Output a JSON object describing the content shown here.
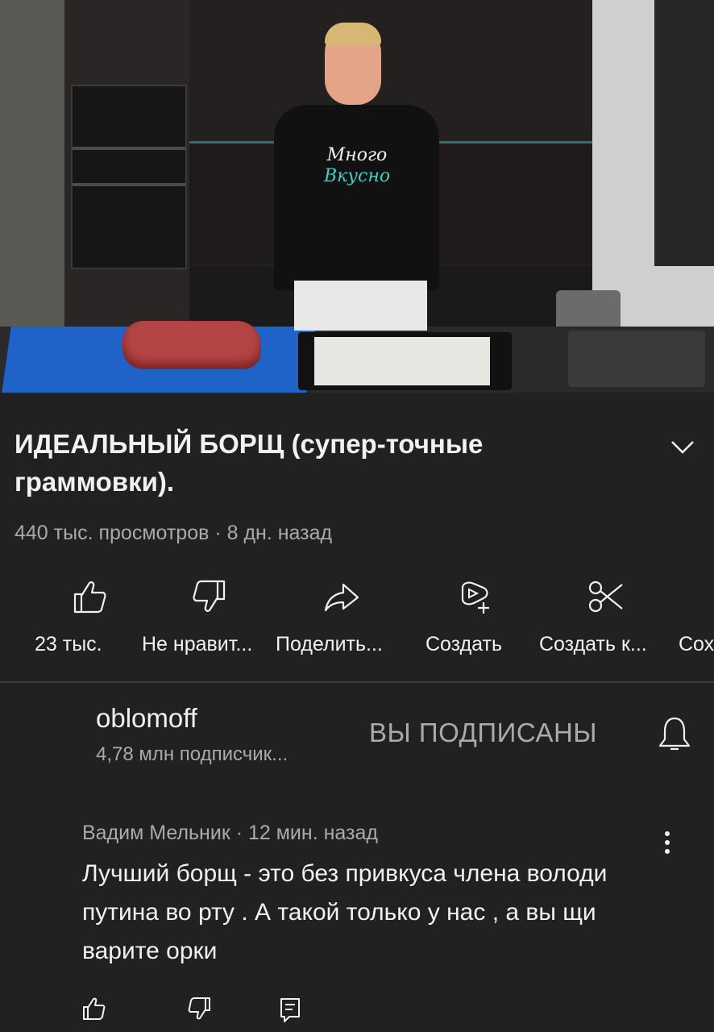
{
  "video": {
    "shirt_text_top": "Много",
    "shirt_text_bottom": "Вкусно"
  },
  "title": "ИДЕАЛЬНЫЙ БОРЩ (супер-точные граммовки).",
  "meta": "440 тыс. просмотров · 8 дн. назад",
  "actions": [
    {
      "icon": "thumbs-up-icon",
      "label": "23 тыс."
    },
    {
      "icon": "thumbs-down-icon",
      "label": "Не нравит..."
    },
    {
      "icon": "share-icon",
      "label": "Поделить..."
    },
    {
      "icon": "remix-icon",
      "label": "Создать"
    },
    {
      "icon": "clip-icon",
      "label": "Создать к..."
    },
    {
      "icon": "save-icon",
      "label": "Сох"
    }
  ],
  "channel": {
    "name": "oblomoff",
    "subscribers": "4,78 млн подписчик...",
    "subscribe_state": "ВЫ ПОДПИСАНЫ"
  },
  "comment": {
    "author_time": "Вадим Мельник · 12 мин. назад",
    "text": "Лучший борщ - это без привкуса члена володи путина во рту . А такой только у нас , а вы щи варите орки"
  },
  "colors": {
    "background": "#212121",
    "text_primary": "#f1f1f1",
    "text_secondary": "#aaaaaa"
  }
}
